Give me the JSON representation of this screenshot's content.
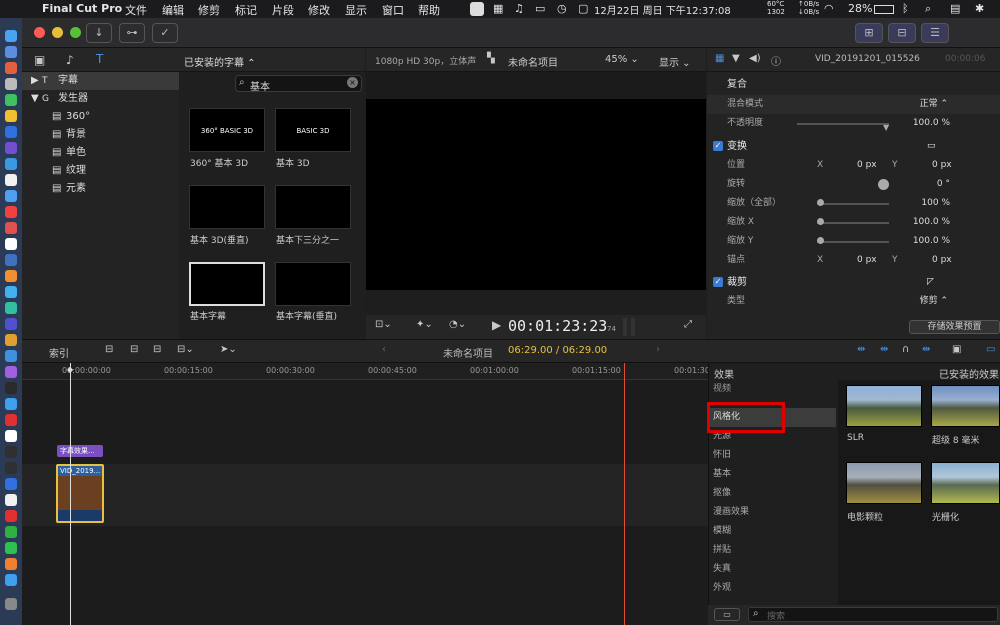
{
  "menubar": {
    "app": "Final Cut Pro",
    "items": [
      "文件",
      "编辑",
      "修剪",
      "标记",
      "片段",
      "修改",
      "显示",
      "窗口",
      "帮助"
    ],
    "temp": "60°C",
    "rpm": "1302",
    "net_up": "0B/s",
    "net_down": "0B/s",
    "battery": "28%",
    "datetime": "12月22日 周日 下午12:37:08"
  },
  "browser": {
    "dropdown": "已安装的字幕",
    "search_value": "基本",
    "library": [
      {
        "label": "字幕",
        "icon": "T"
      },
      {
        "label": "发生器",
        "icon": "G"
      },
      {
        "label": "360°"
      },
      {
        "label": "背景"
      },
      {
        "label": "单色"
      },
      {
        "label": "纹理"
      },
      {
        "label": "元素"
      }
    ],
    "thumbs": [
      {
        "title": "360° BASIC 3D",
        "label": "360° 基本 3D"
      },
      {
        "title": "BASIC 3D",
        "label": "基本 3D"
      },
      {
        "title": "",
        "label": "基本 3D(垂直)"
      },
      {
        "title": "",
        "label": "基本下三分之一"
      },
      {
        "title": "",
        "label": "基本字幕"
      },
      {
        "title": "",
        "label": "基本字幕(垂直)"
      }
    ]
  },
  "viewer": {
    "format": "1080p HD 30p，立体声",
    "project": "未命名项目",
    "zoom": "45%",
    "view_menu": "显示",
    "timecode": "00:01:23:23",
    "timecode_frames": "74"
  },
  "inspector": {
    "clip_name": "VID_20191201_015526",
    "clip_time": "00:00:06",
    "compositing": "复合",
    "blend_label": "混合模式",
    "blend_value": "正常",
    "opacity_label": "不透明度",
    "opacity_value": "100.0 %",
    "transform": "变换",
    "position_label": "位置",
    "x": "X",
    "y": "Y",
    "pos_x": "0 px",
    "pos_y": "0 px",
    "rotation_label": "旋转",
    "rotation_value": "0 °",
    "scale_all_label": "缩放（全部）",
    "scale_all_value": "100 %",
    "scale_x_label": "缩放 X",
    "scale_x_value": "100.0 %",
    "scale_y_label": "缩放 Y",
    "scale_y_value": "100.0 %",
    "anchor_label": "锚点",
    "anchor_x": "0 px",
    "anchor_y": "0 px",
    "crop": "裁剪",
    "type_label": "类型",
    "type_value": "修剪",
    "save_preset": "存储效果预置"
  },
  "timeline": {
    "index": "索引",
    "project": "未命名项目",
    "time": "06:29.00 / 06:29.00",
    "ruler": [
      "00:00:00:00",
      "00:00:15:00",
      "00:00:30:00",
      "00:00:45:00",
      "00:01:00:00",
      "00:01:15:00",
      "00:01:30"
    ],
    "title_clip": "字幕效果...",
    "video_clip": "VID_2019..."
  },
  "effects": {
    "title": "效果",
    "installed": "已安装的效果",
    "categories": [
      "视频",
      "风格化",
      "光源",
      "怀旧",
      "基本",
      "抠像",
      "漫画效果",
      "模糊",
      "拼贴",
      "失真",
      "外观"
    ],
    "selected": "风格化",
    "items": [
      "SLR",
      "超级 8 毫米",
      "电影颗粒",
      "光栅化"
    ],
    "search_placeholder": "搜索"
  },
  "colors": {
    "accent": "#3a7bd5",
    "selection": "#e8c040",
    "highlight_box": "#e00000",
    "playhead": "#e05030"
  }
}
